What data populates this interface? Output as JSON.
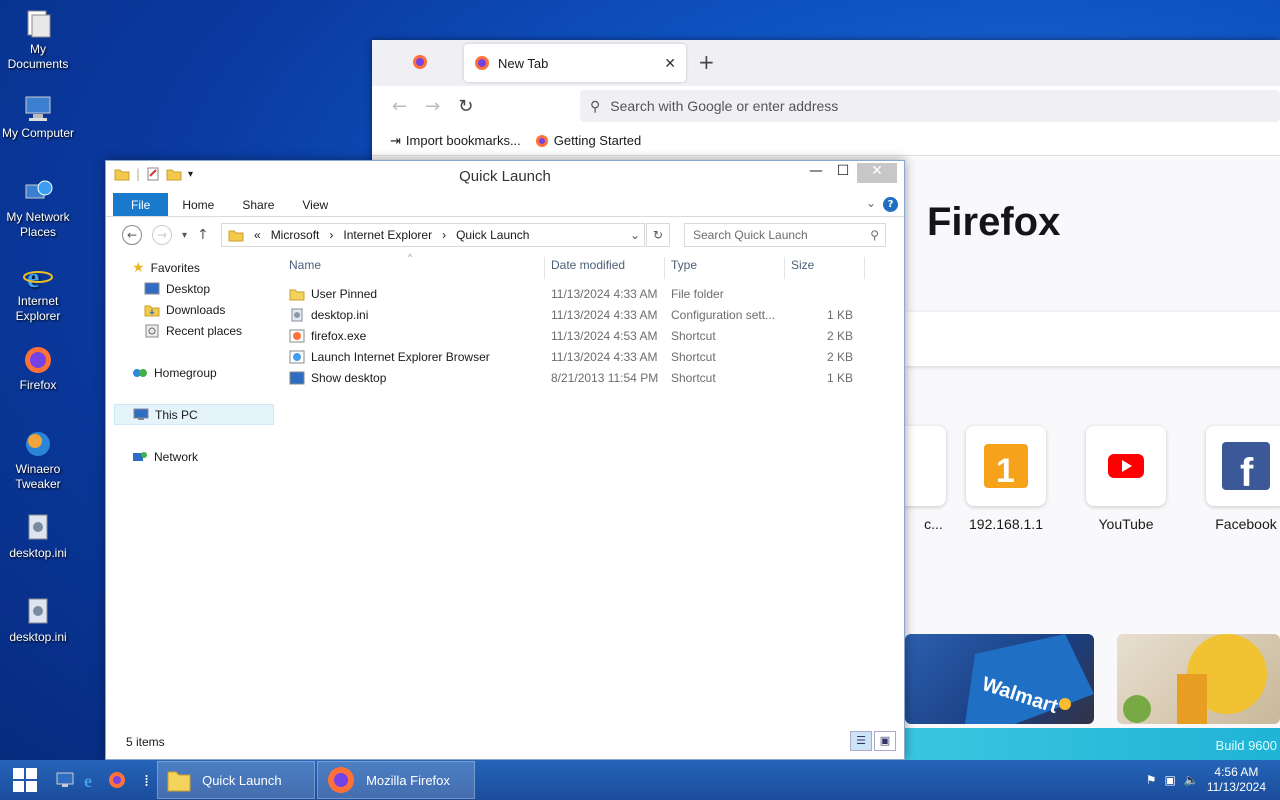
{
  "desktop": {
    "icons": [
      {
        "label": "My Documents"
      },
      {
        "label": "My Computer"
      },
      {
        "label": "My Network Places"
      },
      {
        "label": "Internet Explorer"
      },
      {
        "label": "Firefox"
      },
      {
        "label": "Winaero Tweaker"
      },
      {
        "label": "desktop.ini"
      },
      {
        "label": "desktop.ini"
      }
    ]
  },
  "firefox": {
    "tab_title": "New Tab",
    "url_placeholder": "Search with Google or enter address",
    "bookmarks": [
      "Import bookmarks...",
      "Getting Started"
    ],
    "brand": "Firefox",
    "shortcuts": [
      {
        "label": "c..."
      },
      {
        "label": "192.168.1.1"
      },
      {
        "label": "YouTube"
      },
      {
        "label": "Facebook"
      }
    ],
    "build_text": "Build 9600"
  },
  "explorer": {
    "title": "Quick Launch",
    "ribbon_tabs": [
      "File",
      "Home",
      "Share",
      "View"
    ],
    "breadcrumb": [
      "Microsoft",
      "Internet Explorer",
      "Quick Launch"
    ],
    "search_placeholder": "Search Quick Launch",
    "nav": {
      "favorites": "Favorites",
      "favorites_items": [
        "Desktop",
        "Downloads",
        "Recent places"
      ],
      "homegroup": "Homegroup",
      "this_pc": "This PC",
      "network": "Network"
    },
    "columns": [
      "Name",
      "Date modified",
      "Type",
      "Size"
    ],
    "files": [
      {
        "name": "User Pinned",
        "date": "11/13/2024 4:33 AM",
        "type": "File folder",
        "size": ""
      },
      {
        "name": "desktop.ini",
        "date": "11/13/2024 4:33 AM",
        "type": "Configuration sett...",
        "size": "1 KB"
      },
      {
        "name": "firefox.exe",
        "date": "11/13/2024 4:53 AM",
        "type": "Shortcut",
        "size": "2 KB"
      },
      {
        "name": "Launch Internet Explorer Browser",
        "date": "11/13/2024 4:33 AM",
        "type": "Shortcut",
        "size": "2 KB"
      },
      {
        "name": "Show desktop",
        "date": "8/21/2013 11:54 PM",
        "type": "Shortcut",
        "size": "1 KB"
      }
    ],
    "status": "5 items"
  },
  "taskbar": {
    "tasks": [
      "Quick Launch",
      "Mozilla Firefox"
    ],
    "time": "4:56 AM",
    "date": "11/13/2024"
  },
  "colors": {
    "accent": "#1979ca",
    "taskbar": "#1b4d9c"
  }
}
